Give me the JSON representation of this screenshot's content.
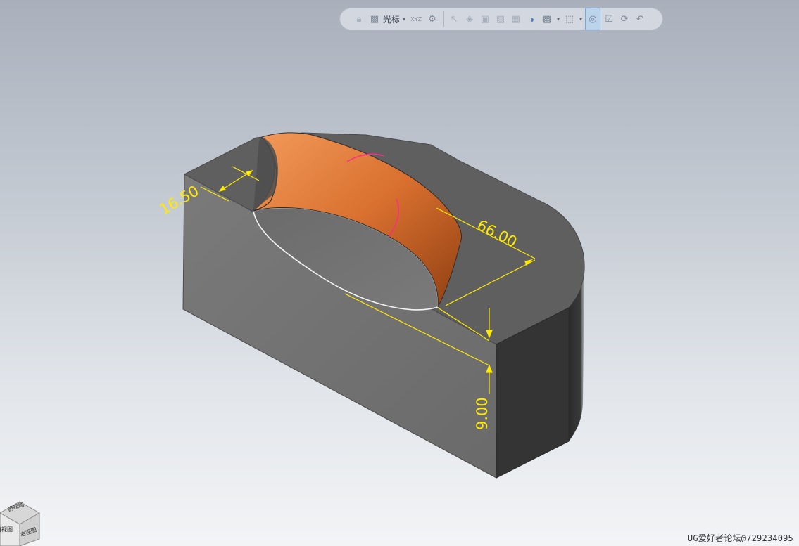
{
  "toolbar": {
    "cursor_label": "光标",
    "xyz_label": "XYZ",
    "buttons": [
      "lock-icon",
      "select-cursor-icon",
      "xyz-coord-icon",
      "snap-point-icon",
      "select-arrow-icon",
      "face-snap-icon",
      "edge-snap-icon",
      "body-snap-icon",
      "solid-cube-icon",
      "section-view-icon",
      "select-filter-icon",
      "box-select-icon",
      "highlight-icon",
      "select-check-icon",
      "rotate-icon",
      "undo-arrow-icon"
    ]
  },
  "dimensions": {
    "width_top": "16.50",
    "length": "66.00",
    "height": "9.00"
  },
  "view_cube": {
    "top_face": "俯视图",
    "left_face": "前视图",
    "right_face": "右视图"
  },
  "watermark": "UG爱好者论坛@729234095",
  "colors": {
    "dimension": "#ffea00",
    "cut_surface": "#d36a2d",
    "body": "#6f6f6f",
    "body_top": "#5e5e5e",
    "background_top": "#a9b0bc",
    "background_bottom": "#f3f4f6"
  }
}
